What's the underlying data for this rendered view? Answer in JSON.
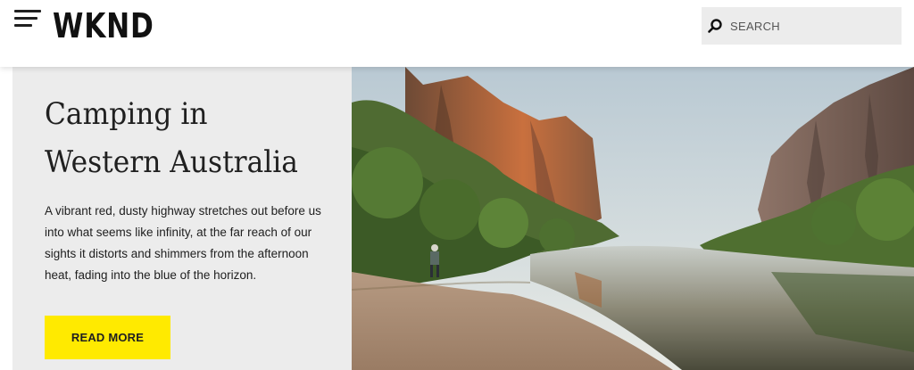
{
  "header": {
    "logo": "WKND",
    "search_placeholder": "SEARCH"
  },
  "hero": {
    "title": "Camping in Western Australia",
    "description": "A vibrant red, dusty highway stretches out before us into what seems like infinity, at the far reach of our sights it distorts and shimmers from the afternoon heat, fading into the blue of the horizon.",
    "button_label": "READ MORE",
    "button_color": "#ffea00",
    "image_subject": "gorge-river-landscape"
  },
  "icons": {
    "menu": "menu-icon",
    "search": "search-icon"
  }
}
